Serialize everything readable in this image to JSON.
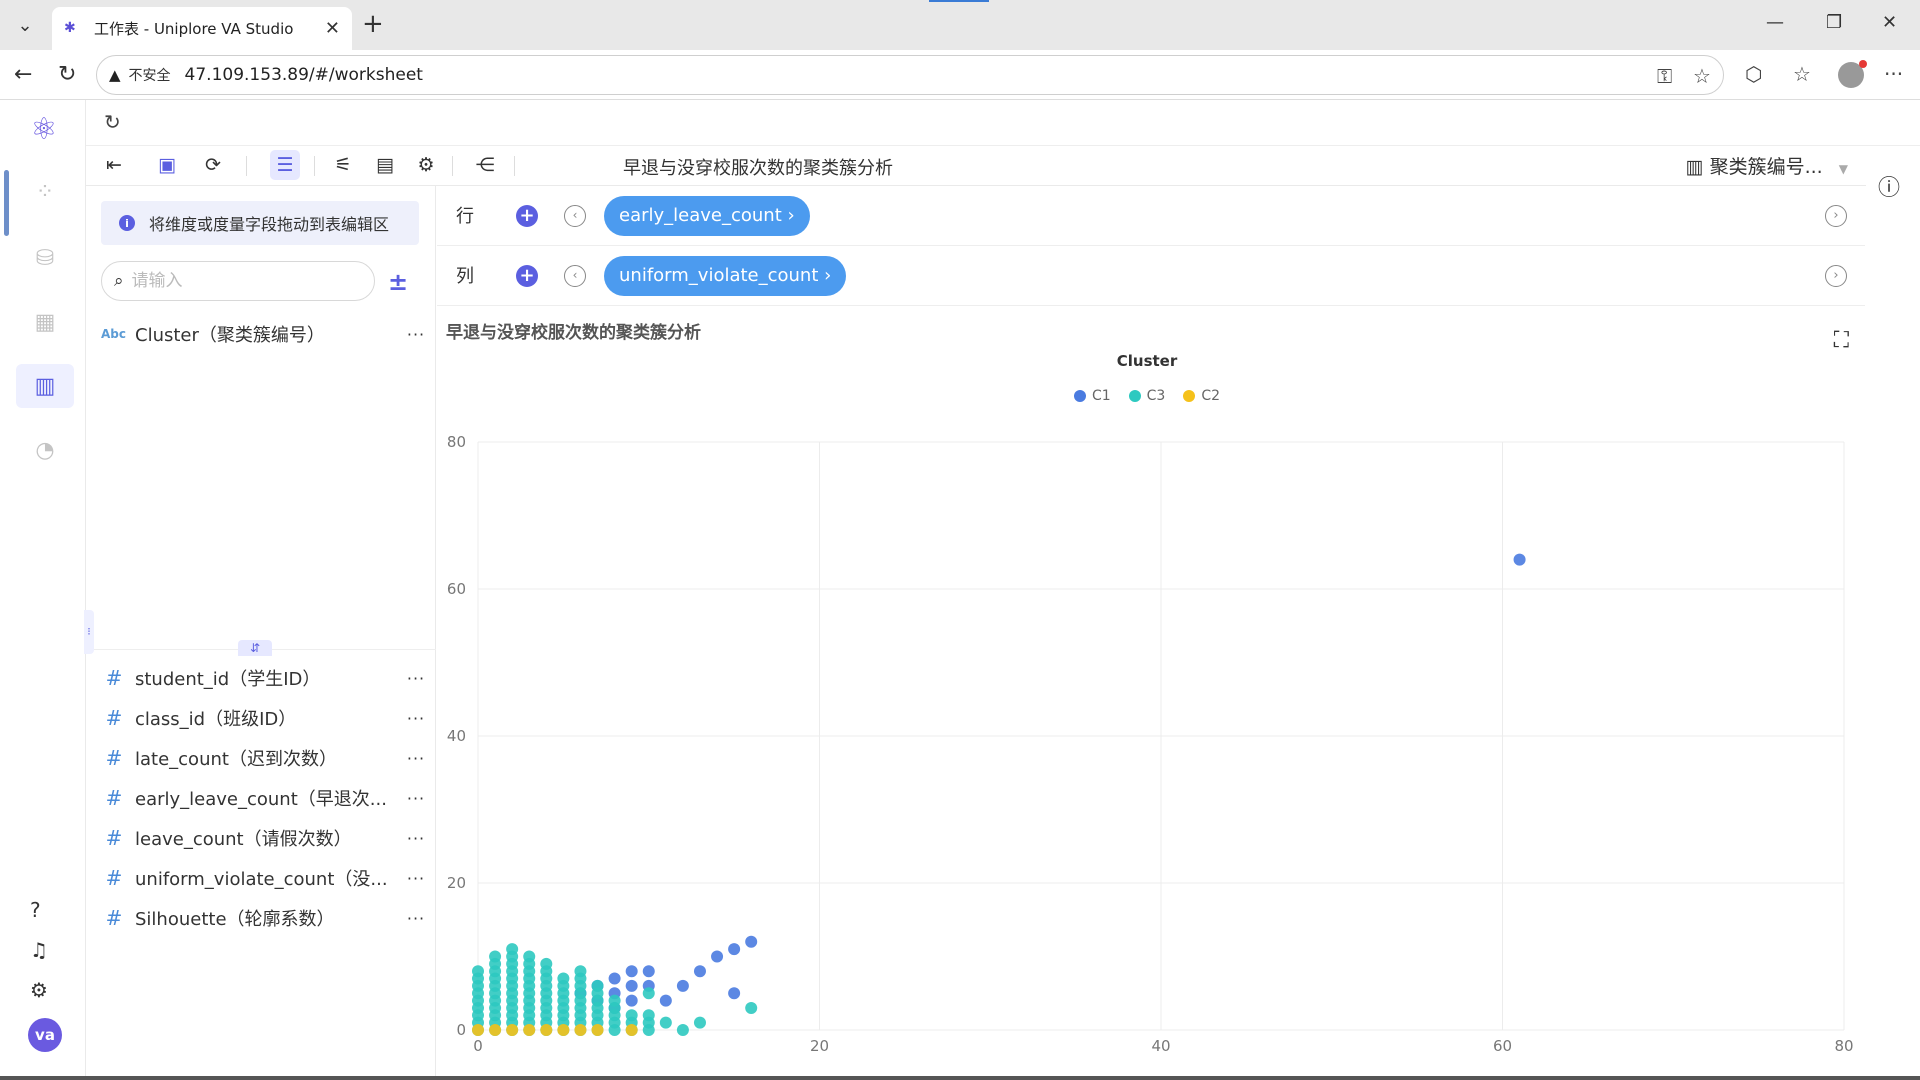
{
  "browser": {
    "tab_title": "工作表 - Uniplore VA Studio",
    "insecure_label": "不安全",
    "url": "47.109.153.89/#/worksheet"
  },
  "toolbar": {
    "sheet_title": "早退与没穿校服次数的聚类簇分析",
    "view_select": "聚类簇编号..."
  },
  "field_panel": {
    "hint": "将维度或度量字段拖动到表编辑区",
    "search_placeholder": "请输入",
    "dimensions": [
      {
        "type": "Abc",
        "label": "Cluster（聚类簇编号）"
      }
    ],
    "measures": [
      {
        "type": "#",
        "label": "student_id（学生ID）"
      },
      {
        "type": "#",
        "label": "class_id（班级ID）"
      },
      {
        "type": "#",
        "label": "late_count（迟到次数）"
      },
      {
        "type": "#",
        "label": "early_leave_count（早退次..."
      },
      {
        "type": "#",
        "label": "leave_count（请假次数）"
      },
      {
        "type": "#",
        "label": "uniform_violate_count（没..."
      },
      {
        "type": "#",
        "label": "Silhouette（轮廓系数）"
      }
    ],
    "more": "···"
  },
  "shelves": {
    "rows_label": "行",
    "rows_pill": "early_leave_count ›",
    "cols_label": "列",
    "cols_pill": "uniform_violate_count ›"
  },
  "rail": {
    "avatar": "va"
  },
  "chart_data": {
    "type": "scatter",
    "title": "早退与没穿校服次数的聚类簇分析",
    "legend_title": "Cluster",
    "legend_position": "top-center",
    "xlabel": "",
    "ylabel": "",
    "xlim": [
      0,
      80
    ],
    "ylim": [
      0,
      80
    ],
    "x_ticks": [
      0,
      20,
      40,
      60,
      80
    ],
    "y_ticks": [
      0,
      20,
      40,
      60,
      80
    ],
    "grid": true,
    "series": [
      {
        "name": "C1",
        "color": "#4a7be0",
        "points": [
          [
            6,
            5
          ],
          [
            7,
            6
          ],
          [
            7,
            4
          ],
          [
            8,
            7
          ],
          [
            8,
            5
          ],
          [
            8,
            3
          ],
          [
            9,
            8
          ],
          [
            9,
            6
          ],
          [
            9,
            4
          ],
          [
            10,
            8
          ],
          [
            10,
            6
          ],
          [
            11,
            4
          ],
          [
            12,
            6
          ],
          [
            13,
            8
          ],
          [
            14,
            10
          ],
          [
            15,
            11
          ],
          [
            15,
            5
          ],
          [
            16,
            12
          ],
          [
            61,
            64
          ]
        ]
      },
      {
        "name": "C3",
        "color": "#2dc9c0",
        "points": [
          [
            0,
            0
          ],
          [
            0,
            1
          ],
          [
            0,
            2
          ],
          [
            0,
            3
          ],
          [
            0,
            4
          ],
          [
            0,
            5
          ],
          [
            0,
            6
          ],
          [
            0,
            7
          ],
          [
            0,
            8
          ],
          [
            1,
            0
          ],
          [
            1,
            1
          ],
          [
            1,
            2
          ],
          [
            1,
            3
          ],
          [
            1,
            4
          ],
          [
            1,
            5
          ],
          [
            1,
            6
          ],
          [
            1,
            7
          ],
          [
            1,
            8
          ],
          [
            1,
            9
          ],
          [
            1,
            10
          ],
          [
            2,
            0
          ],
          [
            2,
            1
          ],
          [
            2,
            2
          ],
          [
            2,
            3
          ],
          [
            2,
            4
          ],
          [
            2,
            5
          ],
          [
            2,
            6
          ],
          [
            2,
            7
          ],
          [
            2,
            8
          ],
          [
            2,
            9
          ],
          [
            2,
            10
          ],
          [
            2,
            11
          ],
          [
            3,
            0
          ],
          [
            3,
            1
          ],
          [
            3,
            2
          ],
          [
            3,
            3
          ],
          [
            3,
            4
          ],
          [
            3,
            5
          ],
          [
            3,
            6
          ],
          [
            3,
            7
          ],
          [
            3,
            8
          ],
          [
            3,
            9
          ],
          [
            3,
            10
          ],
          [
            4,
            0
          ],
          [
            4,
            1
          ],
          [
            4,
            2
          ],
          [
            4,
            3
          ],
          [
            4,
            4
          ],
          [
            4,
            5
          ],
          [
            4,
            6
          ],
          [
            4,
            7
          ],
          [
            4,
            8
          ],
          [
            4,
            9
          ],
          [
            5,
            0
          ],
          [
            5,
            1
          ],
          [
            5,
            2
          ],
          [
            5,
            3
          ],
          [
            5,
            4
          ],
          [
            5,
            5
          ],
          [
            5,
            6
          ],
          [
            5,
            7
          ],
          [
            6,
            0
          ],
          [
            6,
            1
          ],
          [
            6,
            2
          ],
          [
            6,
            3
          ],
          [
            6,
            4
          ],
          [
            6,
            5
          ],
          [
            6,
            6
          ],
          [
            6,
            7
          ],
          [
            6,
            8
          ],
          [
            7,
            0
          ],
          [
            7,
            1
          ],
          [
            7,
            2
          ],
          [
            7,
            3
          ],
          [
            7,
            4
          ],
          [
            7,
            5
          ],
          [
            7,
            6
          ],
          [
            8,
            0
          ],
          [
            8,
            1
          ],
          [
            8,
            2
          ],
          [
            8,
            3
          ],
          [
            8,
            4
          ],
          [
            9,
            0
          ],
          [
            9,
            1
          ],
          [
            9,
            2
          ],
          [
            10,
            0
          ],
          [
            10,
            1
          ],
          [
            10,
            2
          ],
          [
            10,
            5
          ],
          [
            11,
            1
          ],
          [
            12,
            0
          ],
          [
            13,
            1
          ],
          [
            16,
            3
          ]
        ]
      },
      {
        "name": "C2",
        "color": "#f5c11a",
        "points": [
          [
            0,
            0
          ],
          [
            1,
            0
          ],
          [
            2,
            0
          ],
          [
            3,
            0
          ],
          [
            4,
            0
          ],
          [
            5,
            0
          ],
          [
            6,
            0
          ],
          [
            7,
            0
          ],
          [
            9,
            0
          ]
        ]
      }
    ]
  }
}
